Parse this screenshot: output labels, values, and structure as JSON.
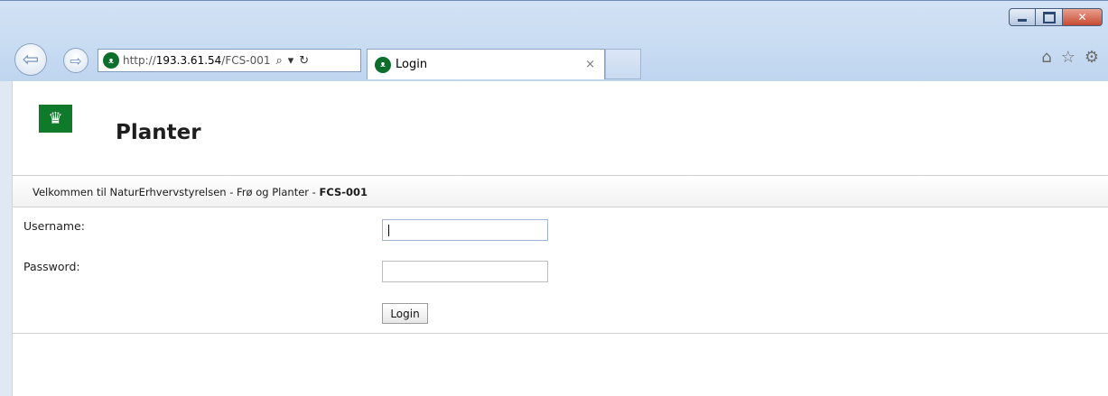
{
  "browser": {
    "url_prefix": "http://",
    "url_host": "193.3.61.54",
    "url_path": "/FCS-001",
    "search_glyph": "⌕",
    "dropdown_glyph": "▾",
    "refresh_glyph": "↻",
    "tab_title": "Login",
    "tab_close": "×",
    "back_glyph": "⇦",
    "forward_glyph": "⇨",
    "home_glyph": "⌂",
    "favorites_glyph": "☆",
    "settings_glyph": "⚙",
    "close_glyph": "✕"
  },
  "header": {
    "logo_glyph": "♛",
    "title": "Planter"
  },
  "welcome": {
    "text": "Velkommen til NaturErhvervstyrelsen - Frø og Planter - ",
    "code": "FCS-001"
  },
  "form": {
    "username_label": "Username:",
    "password_label": "Password:",
    "username_value": "",
    "password_value": "",
    "login_label": "Login"
  },
  "colors": {
    "brand_green": "#0e7a2a",
    "chrome_blue": "#c7dbf2"
  }
}
